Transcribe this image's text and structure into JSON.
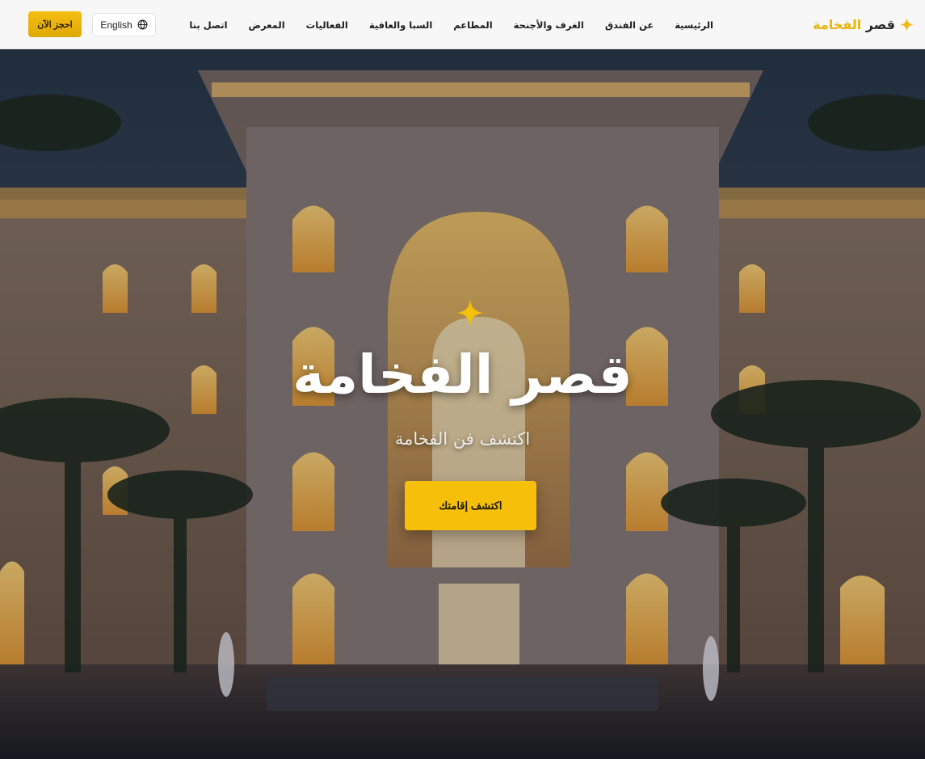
{
  "header": {
    "brand_prefix": "قصر ",
    "brand_accent": "الفخامة",
    "nav": [
      {
        "label": "الرئيسية"
      },
      {
        "label": "عن الفندق"
      },
      {
        "label": "الغرف والأجنحة"
      },
      {
        "label": "المطاعم"
      },
      {
        "label": "السبا والعافية"
      },
      {
        "label": "الفعاليات"
      },
      {
        "label": "المعرض"
      },
      {
        "label": "اتصل بنا"
      }
    ],
    "language_label": "English",
    "book_label": "احجز الآن"
  },
  "hero": {
    "title": "قصر الفخامة",
    "subtitle": "اكتشف فن الفخامة",
    "cta_label": "اكتشف إقامتك"
  },
  "icons": {
    "brand": "sparkle-star-icon",
    "language": "globe-icon",
    "hero": "sparkle-star-icon"
  },
  "colors": {
    "accent": "#f6bf09",
    "header_bg": "#f7f7f8",
    "text_dark": "#1e1e1e",
    "hero_title": "#ffffff"
  }
}
